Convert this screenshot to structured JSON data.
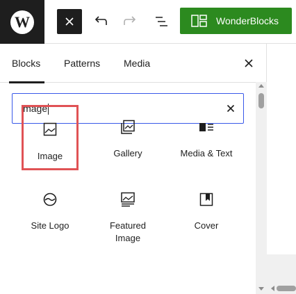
{
  "toolbar": {
    "logo": "W",
    "wonderblocks_label": "WonderBlocks"
  },
  "tabs": [
    {
      "label": "Blocks"
    },
    {
      "label": "Patterns"
    },
    {
      "label": "Media"
    }
  ],
  "search": {
    "value": "image"
  },
  "blocks": [
    {
      "label": "Image",
      "icon": "image-icon"
    },
    {
      "label": "Gallery",
      "icon": "gallery-icon"
    },
    {
      "label": "Media & Text",
      "icon": "media-text-icon"
    },
    {
      "label": "Site Logo",
      "icon": "site-logo-icon"
    },
    {
      "label": "Featured Image",
      "icon": "featured-image-icon"
    },
    {
      "label": "Cover",
      "icon": "cover-icon"
    }
  ],
  "colors": {
    "accent_green": "#2c8a1f",
    "focus_blue": "#3858e9",
    "highlight_red": "#e05255",
    "dark": "#1e1e1e"
  }
}
